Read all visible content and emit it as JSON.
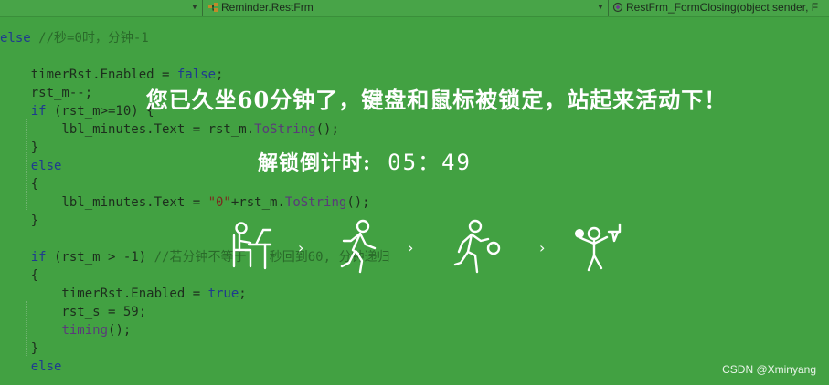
{
  "toolbar": {
    "left_dropdown": "",
    "class_label": "Reminder.RestFrm",
    "method_label": "RestFrm_FormClosing(object sender, F"
  },
  "code_lines": [
    {
      "parts": [
        {
          "t": "else ",
          "c": "kw"
        },
        {
          "t": "//秒=0时，分钟-1",
          "c": "cm"
        }
      ]
    },
    {
      "parts": [
        {
          "t": "",
          "c": ""
        }
      ]
    },
    {
      "parts": [
        {
          "t": "    timerRst.Enabled = ",
          "c": ""
        },
        {
          "t": "false",
          "c": "kw"
        },
        {
          "t": ";",
          "c": ""
        }
      ]
    },
    {
      "parts": [
        {
          "t": "    rst_m--;",
          "c": ""
        }
      ]
    },
    {
      "parts": [
        {
          "t": "    ",
          "c": ""
        },
        {
          "t": "if",
          "c": "kw"
        },
        {
          "t": " (rst_m>=10) {",
          "c": ""
        }
      ]
    },
    {
      "parts": [
        {
          "t": "        lbl_minutes.Text = rst_m.",
          "c": ""
        },
        {
          "t": "ToString",
          "c": "fn"
        },
        {
          "t": "();",
          "c": ""
        }
      ]
    },
    {
      "parts": [
        {
          "t": "    }",
          "c": ""
        }
      ]
    },
    {
      "parts": [
        {
          "t": "    ",
          "c": ""
        },
        {
          "t": "else",
          "c": "kw"
        }
      ]
    },
    {
      "parts": [
        {
          "t": "    {",
          "c": ""
        }
      ]
    },
    {
      "parts": [
        {
          "t": "        lbl_minutes.Text = ",
          "c": ""
        },
        {
          "t": "\"0\"",
          "c": "st"
        },
        {
          "t": "+rst_m.",
          "c": ""
        },
        {
          "t": "ToString",
          "c": "fn"
        },
        {
          "t": "();",
          "c": ""
        }
      ]
    },
    {
      "parts": [
        {
          "t": "    }",
          "c": ""
        }
      ]
    },
    {
      "parts": [
        {
          "t": "",
          "c": ""
        }
      ]
    },
    {
      "parts": [
        {
          "t": "    ",
          "c": ""
        },
        {
          "t": "if",
          "c": "kw"
        },
        {
          "t": " (rst_m > -1) ",
          "c": ""
        },
        {
          "t": "//若分钟不等于   秒回到60, 分钟递归",
          "c": "cm"
        }
      ]
    },
    {
      "parts": [
        {
          "t": "    {",
          "c": ""
        }
      ]
    },
    {
      "parts": [
        {
          "t": "        timerRst.Enabled = ",
          "c": ""
        },
        {
          "t": "true",
          "c": "kw"
        },
        {
          "t": ";",
          "c": ""
        }
      ]
    },
    {
      "parts": [
        {
          "t": "        rst_s = 59;",
          "c": ""
        }
      ]
    },
    {
      "parts": [
        {
          "t": "        ",
          "c": ""
        },
        {
          "t": "timing",
          "c": "fn"
        },
        {
          "t": "();",
          "c": ""
        }
      ]
    },
    {
      "parts": [
        {
          "t": "    }",
          "c": ""
        }
      ]
    },
    {
      "parts": [
        {
          "t": "    ",
          "c": ""
        },
        {
          "t": "else",
          "c": "kw"
        }
      ]
    }
  ],
  "overlay": {
    "message": "您已久坐60分钟了，键盘和鼠标被锁定，站起来活动下！",
    "countdown_label": "解锁倒计时:",
    "countdown_value": "05：49",
    "arrow_glyph": "›"
  },
  "icons": [
    "person-at-desk-icon",
    "person-walking-icon",
    "person-playing-football-icon",
    "person-playing-basketball-icon"
  ],
  "watermark": "CSDN @Xminyang",
  "colors": {
    "background": "#42a142",
    "overlay_text": "#ffffff"
  }
}
